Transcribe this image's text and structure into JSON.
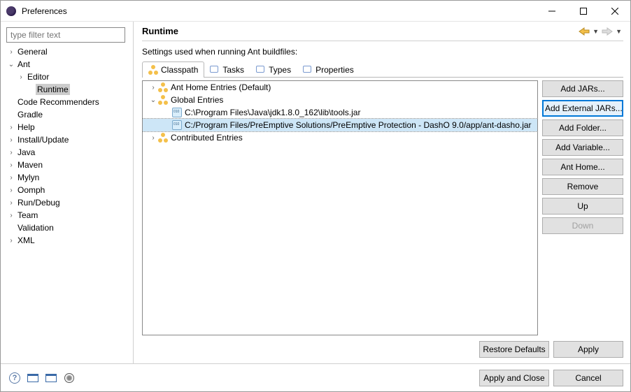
{
  "titlebar": {
    "title": "Preferences"
  },
  "filterPlaceholder": "type filter text",
  "sidebar": {
    "items": [
      {
        "label": "General",
        "indent": 0,
        "twist": "›"
      },
      {
        "label": "Ant",
        "indent": 0,
        "twist": "v"
      },
      {
        "label": "Editor",
        "indent": 1,
        "twist": "›"
      },
      {
        "label": "Runtime",
        "indent": 2,
        "twist": "",
        "selected": true
      },
      {
        "label": "Code Recommenders",
        "indent": 0,
        "twist": ""
      },
      {
        "label": "Gradle",
        "indent": 0,
        "twist": ""
      },
      {
        "label": "Help",
        "indent": 0,
        "twist": "›"
      },
      {
        "label": "Install/Update",
        "indent": 0,
        "twist": "›"
      },
      {
        "label": "Java",
        "indent": 0,
        "twist": "›"
      },
      {
        "label": "Maven",
        "indent": 0,
        "twist": "›"
      },
      {
        "label": "Mylyn",
        "indent": 0,
        "twist": "›"
      },
      {
        "label": "Oomph",
        "indent": 0,
        "twist": "›"
      },
      {
        "label": "Run/Debug",
        "indent": 0,
        "twist": "›"
      },
      {
        "label": "Team",
        "indent": 0,
        "twist": "›"
      },
      {
        "label": "Validation",
        "indent": 0,
        "twist": ""
      },
      {
        "label": "XML",
        "indent": 0,
        "twist": "›"
      }
    ]
  },
  "page": {
    "heading": "Runtime",
    "description": "Settings used when running Ant buildfiles:",
    "tabs": [
      "Classpath",
      "Tasks",
      "Types",
      "Properties"
    ],
    "activeTab": 0,
    "tree": [
      {
        "label": "Ant Home Entries (Default)",
        "indent": 0,
        "twist": "›",
        "icon": "ant-group"
      },
      {
        "label": "Global Entries",
        "indent": 0,
        "twist": "v",
        "icon": "ant-group"
      },
      {
        "label": "C:\\Program Files\\Java\\jdk1.8.0_162\\lib\\tools.jar",
        "indent": 1,
        "twist": "",
        "icon": "jar"
      },
      {
        "label": "C:/Program Files/PreEmptive Solutions/PreEmptive Protection - DashO 9.0/app/ant-dasho.jar",
        "indent": 1,
        "twist": "",
        "icon": "jar",
        "selected": true
      },
      {
        "label": "Contributed Entries",
        "indent": 0,
        "twist": "›",
        "icon": "ant-group"
      }
    ],
    "buttons": {
      "addJars": "Add JARs...",
      "addExternal": "Add External JARs...",
      "addFolder": "Add Folder...",
      "addVariable": "Add Variable...",
      "antHome": "Ant Home...",
      "remove": "Remove",
      "up": "Up",
      "down": "Down"
    },
    "restoreDefaults": "Restore Defaults",
    "apply": "Apply"
  },
  "footer": {
    "applyClose": "Apply and Close",
    "cancel": "Cancel"
  }
}
